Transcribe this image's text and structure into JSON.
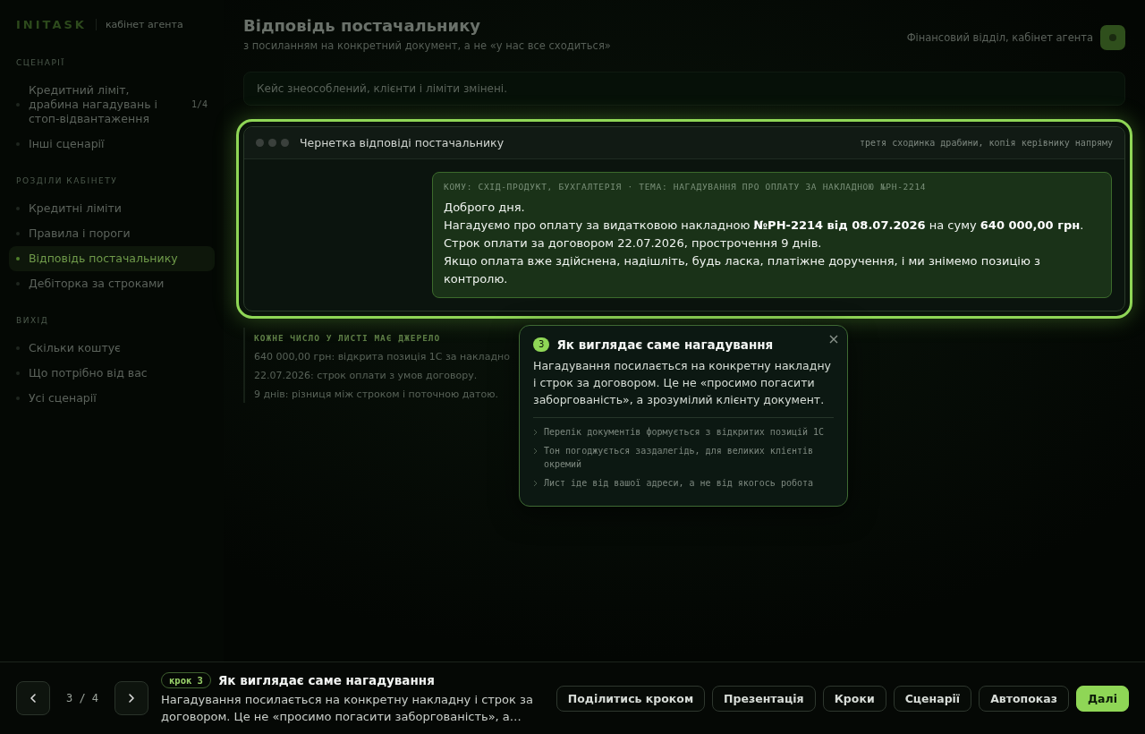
{
  "sidebar": {
    "logo": "INITASK",
    "subtitle": "кабінет агента",
    "sections": [
      {
        "title": "СЦЕНАРІЇ",
        "items": [
          {
            "label": "Кредитний ліміт, драбина нагадувань і стоп-відвантаження",
            "count": "1/4",
            "selected": false
          },
          {
            "label": "Інші сценарії",
            "selected": false
          }
        ]
      },
      {
        "title": "РОЗДІЛИ КАБІНЕТУ",
        "items": [
          {
            "label": "Кредитні ліміти",
            "selected": false
          },
          {
            "label": "Правила і пороги",
            "selected": false
          },
          {
            "label": "Відповідь постачальнику",
            "selected": true
          },
          {
            "label": "Дебіторка за строками",
            "selected": false
          }
        ]
      },
      {
        "title": "ВИХІД",
        "items": [
          {
            "label": "Скільки коштує",
            "selected": false
          },
          {
            "label": "Що потрібно від вас",
            "selected": false
          },
          {
            "label": "Усі сценарії",
            "selected": false
          }
        ]
      }
    ]
  },
  "header": {
    "title": "Відповідь постачальнику",
    "subtitle": "з посиланням на конкретний документ, а не «у нас все сходиться»",
    "account": "Фінансовий відділ, кабінет агента"
  },
  "notice": "Кейс знеособлений, клієнти і ліміти змінені.",
  "draft": {
    "title": "Чернетка відповіді постачальнику",
    "note": "третя сходинка драбини, копія керівнику напряму",
    "email": {
      "meta": "КОМУ: СХІД-ПРОДУКТ, БУХГАЛТЕРІЯ · ТЕМА: НАГАДУВАННЯ ПРО ОПЛАТУ ЗА НАКЛАДНОЮ №РН-2214",
      "lines": [
        "Доброго дня.",
        "Нагадуємо про оплату за видатковою накладною **№РН-2214 від 08.07.2026** на суму **640 000,00 грн**.",
        "Строк оплати за договором 22.07.2026, прострочення 9 днів.",
        "Якщо оплата вже здійснена, надішліть, будь ласка, платіжне доручення, і ми знімемо позицію з контролю."
      ]
    }
  },
  "sources": {
    "title": "КОЖНЕ ЧИСЛО У ЛИСТІ МАЄ ДЖЕРЕЛО",
    "lines": [
      "640 000,00 грн: відкрита позиція 1С за накладно",
      "22.07.2026: строк оплати з умов договору.",
      "9 днів: різниця між строком і поточною датою."
    ]
  },
  "tooltip": {
    "step": "3",
    "title": "Як виглядає саме нагадування",
    "body": "Нагадування посилається на конкретну накладну і строк за договором. Це не «просимо погасити заборгованість», а зрозумілий клієнту документ.",
    "points": [
      "Перелік документів формується з відкритих позицій 1С",
      "Тон погоджується заздалегідь, для великих клієнтів окремий",
      "Лист іде від вашої адреси, а не від якогось робота"
    ]
  },
  "footer": {
    "counter": "3 / 4",
    "step_badge": "крок 3",
    "title": "Як виглядає саме нагадування",
    "description": "Нагадування посилається на конкретну накладну і строк за договором. Це не «просимо погасити заборгованість», а…",
    "buttons": [
      {
        "label": "Поділитись кроком",
        "kind": "outline"
      },
      {
        "label": "Презентація",
        "kind": "outline"
      },
      {
        "label": "Кроки",
        "kind": "outline"
      },
      {
        "label": "Сценарії",
        "kind": "outline"
      },
      {
        "label": "Автопоказ",
        "kind": "outline"
      },
      {
        "label": "Далі",
        "kind": "primary"
      }
    ]
  }
}
